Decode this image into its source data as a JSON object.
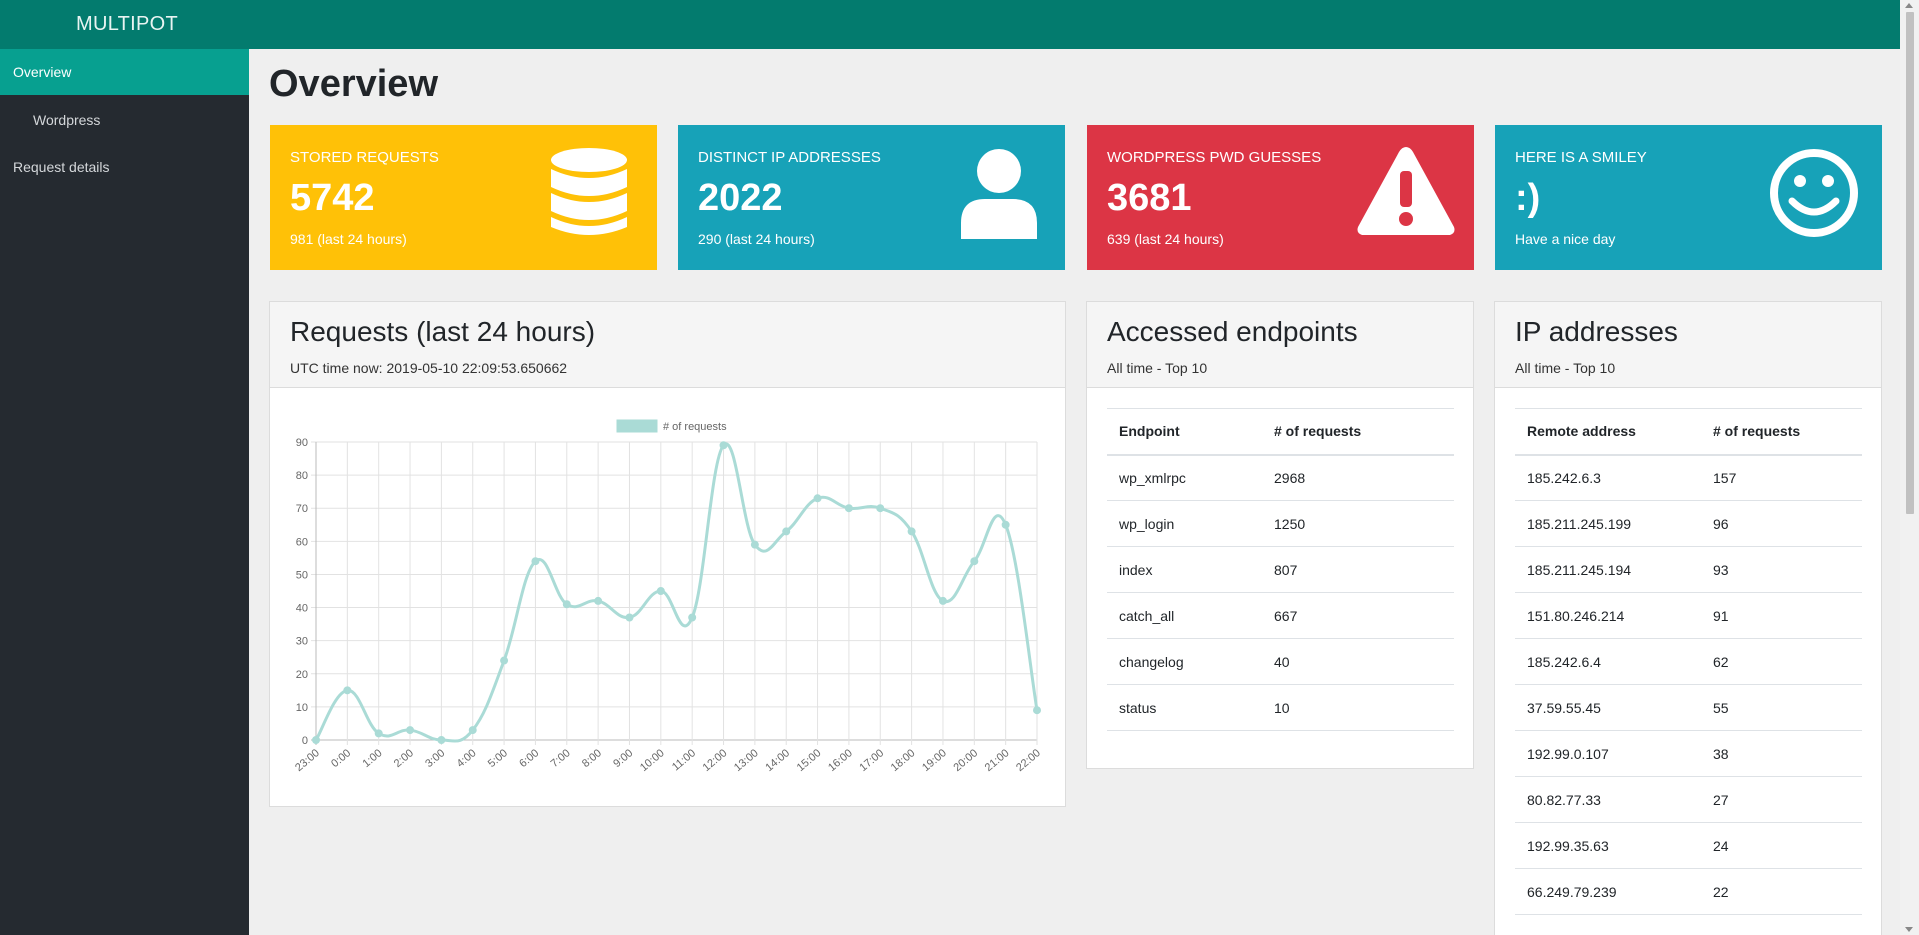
{
  "brand": "MULTIPOT",
  "nav": [
    {
      "label": "Overview",
      "active": true
    },
    {
      "label": "Wordpress",
      "active": false
    },
    {
      "label": "Request details",
      "active": false
    }
  ],
  "page_title": "Overview",
  "stats": [
    {
      "label": "STORED REQUESTS",
      "value": "5742",
      "sub": "981 (last 24 hours)",
      "color": "#ffc107",
      "icon": "database-icon"
    },
    {
      "label": "DISTINCT IP ADDRESSES",
      "value": "2022",
      "sub": "290 (last 24 hours)",
      "color": "#17a2b8",
      "icon": "user-icon"
    },
    {
      "label": "WORDPRESS PWD GUESSES",
      "value": "3681",
      "sub": "639 (last 24 hours)",
      "color": "#dc3545",
      "icon": "warning-icon"
    },
    {
      "label": "HERE IS A SMILEY",
      "value": ":)",
      "sub": "Have a nice day",
      "color": "#17a2b8",
      "icon": "smiley-icon"
    }
  ],
  "requests_card": {
    "title": "Requests (last 24 hours)",
    "subtitle": "UTC time now: 2019-05-10 22:09:53.650662"
  },
  "endpoints_card": {
    "title": "Accessed endpoints",
    "subtitle": "All time - Top 10",
    "columns": [
      "Endpoint",
      "# of requests"
    ],
    "rows": [
      [
        "wp_xmlrpc",
        "2968"
      ],
      [
        "wp_login",
        "1250"
      ],
      [
        "index",
        "807"
      ],
      [
        "catch_all",
        "667"
      ],
      [
        "changelog",
        "40"
      ],
      [
        "status",
        "10"
      ]
    ]
  },
  "ips_card": {
    "title": "IP addresses",
    "subtitle": "All time - Top 10",
    "columns": [
      "Remote address",
      "# of requests"
    ],
    "rows": [
      [
        "185.242.6.3",
        "157"
      ],
      [
        "185.211.245.199",
        "96"
      ],
      [
        "185.211.245.194",
        "93"
      ],
      [
        "151.80.246.214",
        "91"
      ],
      [
        "185.242.6.4",
        "62"
      ],
      [
        "37.59.55.45",
        "55"
      ],
      [
        "192.99.0.107",
        "38"
      ],
      [
        "80.82.77.33",
        "27"
      ],
      [
        "192.99.35.63",
        "24"
      ],
      [
        "66.249.79.239",
        "22"
      ]
    ]
  },
  "chart_data": {
    "type": "line",
    "x": [
      "23:00",
      "0:00",
      "1:00",
      "2:00",
      "3:00",
      "4:00",
      "5:00",
      "6:00",
      "7:00",
      "8:00",
      "9:00",
      "10:00",
      "11:00",
      "12:00",
      "13:00",
      "14:00",
      "15:00",
      "16:00",
      "17:00",
      "18:00",
      "19:00",
      "20:00",
      "21:00",
      "22:00"
    ],
    "series": [
      {
        "name": "# of requests",
        "values": [
          0,
          15,
          2,
          3,
          0,
          3,
          24,
          54,
          41,
          42,
          37,
          45,
          37,
          89,
          59,
          63,
          73,
          70,
          70,
          63,
          42,
          54,
          65,
          9
        ],
        "color": "#aadbd6"
      }
    ],
    "ylim": [
      0,
      90
    ],
    "yticks": [
      0,
      10,
      20,
      30,
      40,
      50,
      60,
      70,
      80,
      90
    ],
    "grid": true,
    "legend": "top"
  }
}
